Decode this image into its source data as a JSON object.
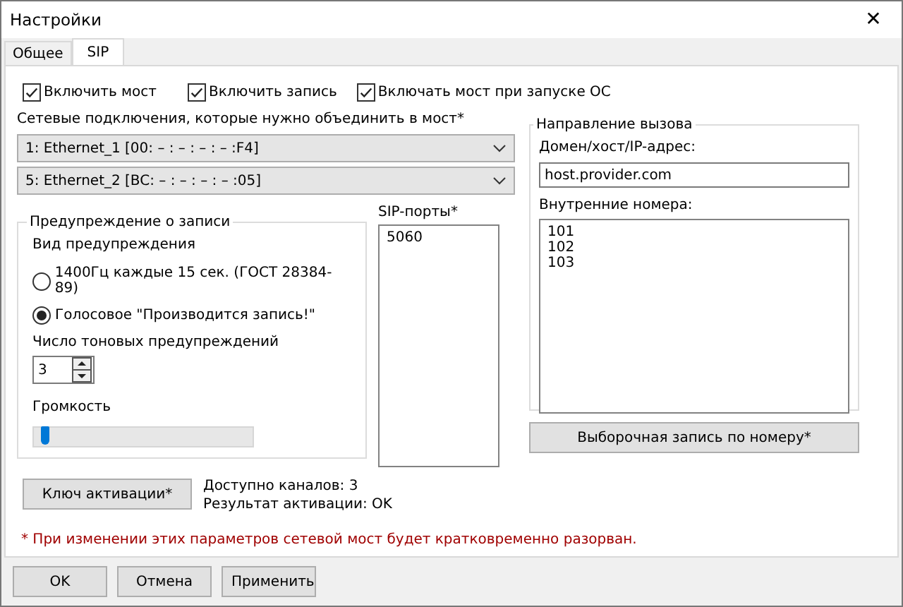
{
  "window": {
    "title": "Настройки",
    "close": "✕"
  },
  "tabs": [
    {
      "label": "Общее",
      "selected": false
    },
    {
      "label": "SIP",
      "selected": true
    }
  ],
  "checkboxes": [
    {
      "label": "Включить мост",
      "checked": true
    },
    {
      "label": "Включить запись",
      "checked": true
    },
    {
      "label": "Включать мост при запуске ОС",
      "checked": true
    }
  ],
  "connections": {
    "label": "Сетевые подключения, которые нужно объединить в мост*",
    "selects": [
      "1: Ethernet_1 [00: – : – : – : – :F4]",
      "5: Ethernet_2 [BC: – : – : – : – :05]"
    ]
  },
  "warning_group": {
    "title": "Предупреждение о записи",
    "type_label": "Вид предупреждения",
    "options": [
      {
        "label": "1400Гц каждые 15 сек. (ГОСТ 28384-89)",
        "selected": false
      },
      {
        "label": "Голосовое \"Производится запись!\"",
        "selected": true
      }
    ],
    "count_label": "Число тоновых предупреждений",
    "count_value": "3",
    "volume_label": "Громкость",
    "volume": {
      "level": 0.03
    }
  },
  "sip_ports": {
    "label": "SIP-порты*",
    "values": [
      "5060"
    ]
  },
  "activation": {
    "button": "Ключ активации*",
    "channels": "Доступно каналов: 3",
    "result": "Результат активации: OK"
  },
  "call_direction": {
    "title": "Направление вызова",
    "host_label": "Домен/хост/IP-адрес:",
    "host_value": "host.provider.com",
    "ext_label": "Внутренние номера:",
    "extensions": [
      "101",
      "102",
      "103"
    ],
    "button": "Выборочная запись по номеру*"
  },
  "footnote": "* При изменении этих параметров сетевой мост будет кратковременно разорван.",
  "buttons": [
    "OK",
    "Отмена",
    "Применить"
  ]
}
